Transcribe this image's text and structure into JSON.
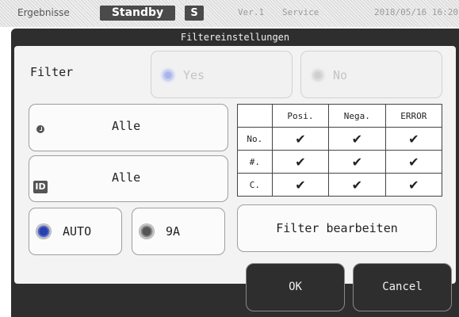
{
  "statusbar": {
    "tab": "Ergebnisse",
    "mode": "Standby",
    "badge": "S",
    "version": "Ver.1",
    "service": "Service",
    "datetime": "2018/05/16 16:20"
  },
  "dialog": {
    "title": "Filtereinstellungen",
    "filter": {
      "label": "Filter",
      "yes_label": "Yes",
      "no_label": "No",
      "yes_enabled": false,
      "no_enabled": false
    },
    "time_select": {
      "value": "Alle",
      "icon": "clock-icon"
    },
    "id_select": {
      "value": "Alle",
      "icon": "id-icon"
    },
    "mode_radio": {
      "auto_label": "AUTO",
      "auto_selected": true,
      "ninea_label": "9A",
      "ninea_selected": false
    },
    "table": {
      "headers": [
        "Posi.",
        "Nega.",
        "ERROR"
      ],
      "rows": [
        {
          "label": "No.",
          "cells": [
            "✔",
            "✔",
            "✔"
          ]
        },
        {
          "label": "#.",
          "cells": [
            "✔",
            "✔",
            "✔"
          ]
        },
        {
          "label": "C.",
          "cells": [
            "✔",
            "✔",
            "✔"
          ]
        }
      ]
    },
    "edit_filter_label": "Filter bearbeiten",
    "ok_label": "OK",
    "cancel_label": "Cancel"
  }
}
